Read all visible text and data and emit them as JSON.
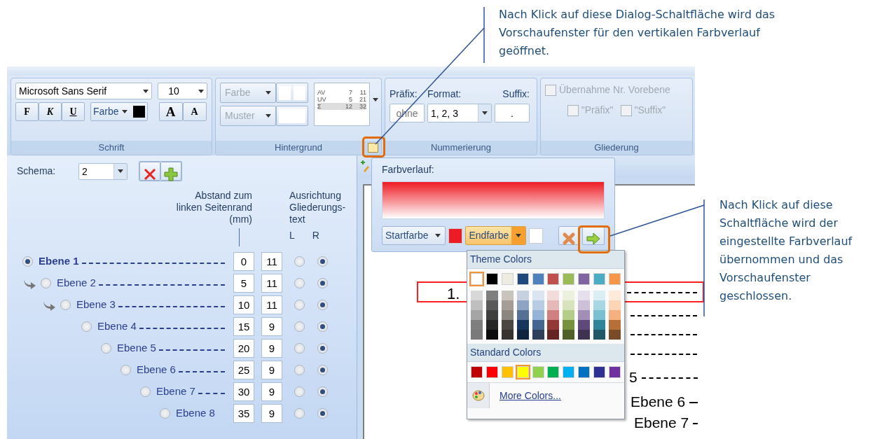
{
  "callouts": [
    {
      "text": "Nach Klick auf diese Dialog-Schaltfläche wird das Vorschaufenster für den vertikalen Farbverlauf geöffnet."
    },
    {
      "text": "Nach Klick auf diese Schaltfläche wird der eingestellte Farbverlauf übernommen und das Vorschaufenster geschlossen."
    }
  ],
  "ribbon": {
    "font_group": {
      "title": "Schrift",
      "font": "Microsoft Sans Serif",
      "size": "10",
      "style_buttons": [
        "F",
        "K",
        "U"
      ],
      "color_button": "Farbe",
      "color": "#000000",
      "grow_buttons": [
        "A",
        "A"
      ]
    },
    "background_group": {
      "title": "Hintergrund",
      "color_button": "Farbe",
      "pattern_button": "Muster",
      "disabled": true,
      "sample_rows": [
        [
          "AV",
          "7",
          "11"
        ],
        [
          "UV",
          "5",
          "21"
        ],
        [
          "Σ",
          "12",
          "32"
        ]
      ]
    },
    "numbering_group": {
      "title": "Nummerierung",
      "prefix_label": "Präfix:",
      "prefix_value": "ohne",
      "format_label": "Format:",
      "format_value": "1, 2, 3",
      "suffix_label": "Suffix:",
      "suffix_value": "."
    },
    "outline_group": {
      "title": "Gliederung",
      "checkboxes": [
        {
          "label": "Übernahme Nr. Vorebene",
          "checked": false,
          "disabled": true
        },
        {
          "label": "\"Präfix\"",
          "checked": false,
          "disabled": true
        },
        {
          "label": "\"Suffix\"",
          "checked": false,
          "disabled": true
        }
      ]
    }
  },
  "schema": {
    "label": "Schema:",
    "value": "2"
  },
  "distance_header": [
    "Abstand zum",
    "linken Seitenrand",
    "(mm)"
  ],
  "alignment_header": [
    "Ausrichtung",
    "Gliederungs-",
    "text"
  ],
  "align_columns": [
    "L",
    "R"
  ],
  "levels": [
    {
      "label": "Ebene 1",
      "selected": true,
      "linked": false,
      "distance": "0",
      "column_2": "11",
      "alignment": [
        {
          "selected": false
        },
        {
          "selected": true
        }
      ]
    },
    {
      "label": "Ebene 2",
      "selected": false,
      "linked": true,
      "distance": "5",
      "column_2": "11",
      "alignment": [
        {
          "selected": false
        },
        {
          "selected": true
        }
      ]
    },
    {
      "label": "Ebene 3",
      "selected": false,
      "linked": true,
      "distance": "10",
      "column_2": "11",
      "alignment": [
        {
          "selected": false
        },
        {
          "selected": true
        }
      ]
    },
    {
      "label": "Ebene 4",
      "selected": false,
      "linked": false,
      "distance": "15",
      "column_2": "9",
      "alignment": [
        {
          "selected": false
        },
        {
          "selected": true
        }
      ]
    },
    {
      "label": "Ebene 5",
      "selected": false,
      "linked": false,
      "distance": "20",
      "column_2": "9",
      "alignment": [
        {
          "selected": false
        },
        {
          "selected": true
        }
      ]
    },
    {
      "label": "Ebene 6",
      "selected": false,
      "linked": false,
      "distance": "25",
      "column_2": "9",
      "alignment": [
        {
          "selected": false
        },
        {
          "selected": true
        }
      ]
    },
    {
      "label": "Ebene 7",
      "selected": false,
      "linked": false,
      "distance": "30",
      "column_2": "9",
      "alignment": [
        {
          "selected": false
        },
        {
          "selected": true
        }
      ]
    },
    {
      "label": "Ebene 8",
      "selected": false,
      "linked": false,
      "distance": "35",
      "column_2": "9",
      "alignment": [
        {
          "selected": false
        },
        {
          "selected": true
        }
      ]
    }
  ],
  "preview": [
    {
      "kind": "boxed",
      "text": "1."
    },
    {
      "kind": "dashes"
    },
    {
      "kind": "dashes"
    },
    {
      "kind": "dashes"
    },
    {
      "kind": "text",
      "text": "5"
    },
    {
      "kind": "text",
      "text": "Ebene 6"
    },
    {
      "kind": "text",
      "text": "Ebene 7"
    }
  ],
  "gradient_popup": {
    "title": "Farbverlauf:",
    "start": {
      "label": "Startfarbe",
      "color": "#ed1c24",
      "open": false
    },
    "end": {
      "label": "Endfarbe",
      "color": "#ffffff",
      "open": true
    }
  },
  "color_menu": {
    "theme_title": "Theme Colors",
    "theme_colors": [
      {
        "color": "#ffffff",
        "selected": true,
        "shades": [
          {
            "color": "#d8d8d8"
          },
          {
            "color": "#bfbfbf"
          },
          {
            "color": "#a5a5a5"
          },
          {
            "color": "#7f7f7f"
          },
          {
            "color": "#7a7a7a"
          }
        ]
      },
      {
        "color": "#000000",
        "selected": false,
        "shades": [
          {
            "color": "#7f7f7f"
          },
          {
            "color": "#595959"
          },
          {
            "color": "#3f3f3f"
          },
          {
            "color": "#262626"
          },
          {
            "color": "#0c0c0c"
          }
        ]
      },
      {
        "color": "#eeece1",
        "selected": false,
        "shades": [
          {
            "color": "#c9c4bc"
          },
          {
            "color": "#a49e96"
          },
          {
            "color": "#8a857e"
          },
          {
            "color": "#4a4642"
          },
          {
            "color": "#363330"
          }
        ]
      },
      {
        "color": "#1f497d",
        "selected": false,
        "shades": [
          {
            "color": "#c6d0de"
          },
          {
            "color": "#8da5c3"
          },
          {
            "color": "#566f94"
          },
          {
            "color": "#17365d"
          },
          {
            "color": "#0f243e"
          }
        ]
      },
      {
        "color": "#4f81bd",
        "selected": false,
        "shades": [
          {
            "color": "#dbe5f1"
          },
          {
            "color": "#b8cce4"
          },
          {
            "color": "#95b3d7"
          },
          {
            "color": "#446690"
          },
          {
            "color": "#2c3f5b"
          }
        ]
      },
      {
        "color": "#c0504d",
        "selected": false,
        "shades": [
          {
            "color": "#f2dcdb"
          },
          {
            "color": "#e5b9b7"
          },
          {
            "color": "#d08080"
          },
          {
            "color": "#953734"
          },
          {
            "color": "#632423"
          }
        ]
      },
      {
        "color": "#9bbb59",
        "selected": false,
        "shades": [
          {
            "color": "#ebf1dd"
          },
          {
            "color": "#d7e3bc"
          },
          {
            "color": "#b5cd8a"
          },
          {
            "color": "#76923c"
          },
          {
            "color": "#4f6128"
          }
        ]
      },
      {
        "color": "#8064a2",
        "selected": false,
        "shades": [
          {
            "color": "#e5e0ec"
          },
          {
            "color": "#ccc1d9"
          },
          {
            "color": "#a18fb8"
          },
          {
            "color": "#5f497a"
          },
          {
            "color": "#3f3151"
          }
        ]
      },
      {
        "color": "#4bacc6",
        "selected": false,
        "shades": [
          {
            "color": "#dbeef3"
          },
          {
            "color": "#a8d6e3"
          },
          {
            "color": "#7ac0d2"
          },
          {
            "color": "#31859b"
          },
          {
            "color": "#205867"
          }
        ]
      },
      {
        "color": "#f79646",
        "selected": false,
        "shades": [
          {
            "color": "#fdeada"
          },
          {
            "color": "#fbd5b5"
          },
          {
            "color": "#f5b07f"
          },
          {
            "color": "#b57038"
          },
          {
            "color": "#7a4b27"
          }
        ]
      }
    ],
    "standard_title": "Standard Colors",
    "standard_colors": [
      {
        "color": "#c00000",
        "selected": false
      },
      {
        "color": "#ff0000",
        "selected": false
      },
      {
        "color": "#ffc000",
        "selected": false
      },
      {
        "color": "#ffff00",
        "selected": true
      },
      {
        "color": "#92d050",
        "selected": false
      },
      {
        "color": "#00b050",
        "selected": false
      },
      {
        "color": "#00b0f0",
        "selected": false
      },
      {
        "color": "#0070c0",
        "selected": false
      },
      {
        "color": "#2e3192",
        "selected": false
      },
      {
        "color": "#7030a0",
        "selected": false
      }
    ],
    "more_label": "More Colors..."
  }
}
